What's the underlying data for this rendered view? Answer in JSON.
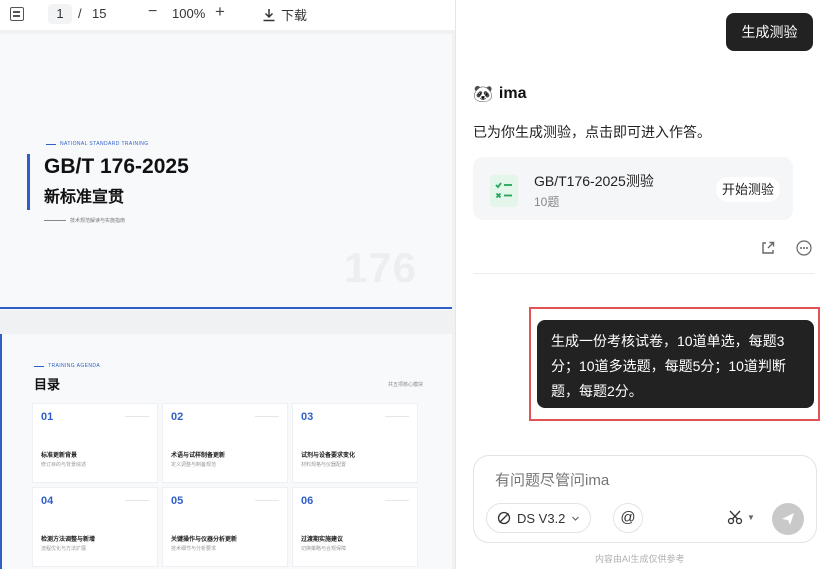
{
  "viewer": {
    "toolbar": {
      "current_page": "1",
      "separator": "/",
      "total_pages": "15",
      "zoom_out": "−",
      "zoom": "100%",
      "zoom_in": "+",
      "download_label": "下载"
    },
    "page1": {
      "eyebrow": "NATIONAL STANDARD TRAINING",
      "title": "GB/T 176-2025",
      "subtitle": "新标准宣贯",
      "tagline": "技术规范解读与实施指南",
      "watermark": "176"
    },
    "page2": {
      "eyebrow": "TRAINING AGENDA",
      "title": "目录",
      "note": "共五项核心模块",
      "cards": [
        {
          "num": "01",
          "title": "标准更新背景",
          "desc": "修订目的与背景综述"
        },
        {
          "num": "02",
          "title": "术语与试样制备更新",
          "desc": "定义调整与制备规范"
        },
        {
          "num": "03",
          "title": "试剂与设备要求变化",
          "desc": "材料规格与仪器配置"
        },
        {
          "num": "04",
          "title": "检测方法调整与新增",
          "desc": "流程优化与方法扩展"
        },
        {
          "num": "05",
          "title": "关键操作与仪器分析更新",
          "desc": "技术细节与分析要求"
        },
        {
          "num": "06",
          "title": "过渡期实施建议",
          "desc": "切换策略与合规保障"
        }
      ]
    }
  },
  "chat": {
    "user_quick_action": "生成测验",
    "bot_name": "ima",
    "bot_message": "已为你生成测验，点击即可进入作答。",
    "quiz": {
      "title": "GB/T176-2025测验",
      "count": "10题",
      "start_label": "开始测验"
    },
    "user_message": "生成一份考核试卷，10道单选，每题3分；10道多选题，每题5分；10道判断题，每题2分。",
    "input": {
      "placeholder": "有问题尽管问ima",
      "model": "DS V3.2",
      "at_label": "@"
    },
    "footer": "内容由AI生成仅供参考"
  },
  "colors": {
    "accent_blue": "#2f5fc6",
    "highlight_red": "#e25353",
    "user_bubble": "#222222"
  }
}
